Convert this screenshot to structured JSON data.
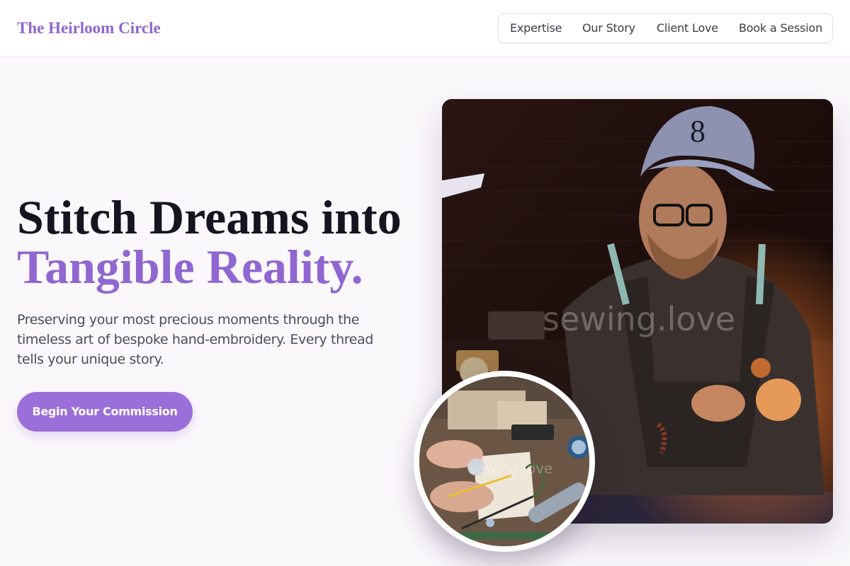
{
  "brand": "The Heirloom Circle",
  "nav": {
    "items": [
      "Expertise",
      "Our Story",
      "Client Love",
      "Book a Session"
    ]
  },
  "hero": {
    "title_line1": "Stitch Dreams into",
    "title_line2": "Tangible Reality.",
    "description": "Preserving your most precious moments through the timeless art of bespoke hand-embroidery. Every thread tells your unique story.",
    "cta_label": "Begin Your Commission"
  },
  "images": {
    "main_watermark": "sewing.love",
    "inset_watermark": "sewing.love"
  },
  "colors": {
    "accent": "#9067d0",
    "button": "#9b6fd9",
    "background": "#fbf8fc",
    "heading": "#14151f"
  }
}
